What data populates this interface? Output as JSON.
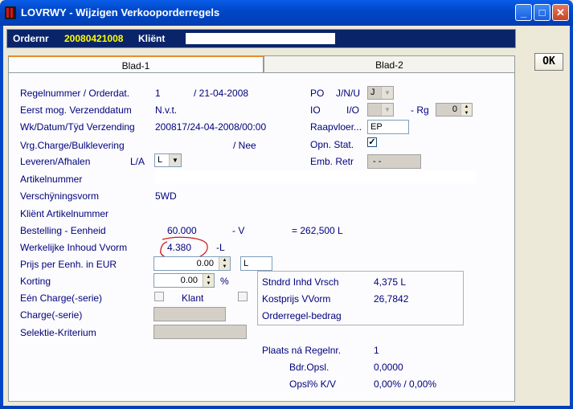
{
  "window": {
    "title": "LOVRWY - Wijzigen Verkooporderregels"
  },
  "header": {
    "ordernr_label": "Ordernr",
    "ordernr_value": "20080421008",
    "client_label": "Kliënt"
  },
  "tabs": [
    {
      "label": "Blad-1"
    },
    {
      "label": "Blad-2"
    }
  ],
  "ok_label": "OK",
  "left": {
    "regelnummer_label": "Regelnummer / Orderdat.",
    "regelnummer_value": "1",
    "orderdat_value": "/ 21-04-2008",
    "eerst_label": "Eerst mog. Verzenddatum",
    "eerst_value": "N.v.t.",
    "wk_label": "Wk/Datum/Tÿd Verzending",
    "wk_value": "200817/24-04-2008/00:00",
    "vrg_label": "Vrg.Charge/Bulklevering",
    "vrg_value": "/ Nee",
    "leveren_label": "Leveren/Afhalen",
    "la_label": "L/A",
    "la_value": "L",
    "artikel_label": "Artikelnummer",
    "verschijning_label": "Verschÿningsvorm",
    "verschijning_value": "5WD",
    "klient_artikel_label": "Kliënt Artikelnummer",
    "bestelling_label": "Bestelling - Eenheid",
    "bestelling_value": "60.000",
    "bestelling_unit": "- V",
    "bestelling_total": "= 262,500 L",
    "werkelijke_label": "Werkelijke Inhoud Vvorm",
    "werkelijke_value": "4.380",
    "werkelijke_unit": "-L",
    "prijs_label": "Prijs per Eenh. in EUR",
    "prijs_value": "0.00",
    "prijs_unit": "L",
    "korting_label": "Korting",
    "korting_value": "0.00",
    "korting_unit": "%",
    "een_charge_label": "Eén Charge(-serie)",
    "klant_label": "Klant",
    "charge_label": "Charge(-serie)",
    "selectie_label": "Selektie-Kriterium"
  },
  "right": {
    "po_label": "PO",
    "jnu_label": "J/N/U",
    "po_value": "J",
    "io_label": "IO",
    "io_sub_label": "I/O",
    "rg_label": "- Rg",
    "rg_value": "0",
    "raapvloer_label": "Raapvloer...",
    "raapvloer_value": "EP",
    "opn_label": "Opn. Stat.",
    "opn_checked": "✓",
    "emb_label": "Emb. Retr",
    "emb_value": "- -"
  },
  "group": {
    "stndrd_label": "Stndrd Inhd Vrsch",
    "stndrd_value": "4,375 L",
    "kostprijs_label": "Kostprijs VVorm",
    "kostprijs_value": "26,7842",
    "orderregel_label": "Orderregel-bedrag"
  },
  "bottom": {
    "plaats_label": "Plaats ná Regelnr.",
    "plaats_value": "1",
    "bdr_label": "Bdr.Opsl.",
    "bdr_value": "0,0000",
    "opsl_label": "Opsl% K/V",
    "opsl_value": "0,00% / 0,00%"
  }
}
